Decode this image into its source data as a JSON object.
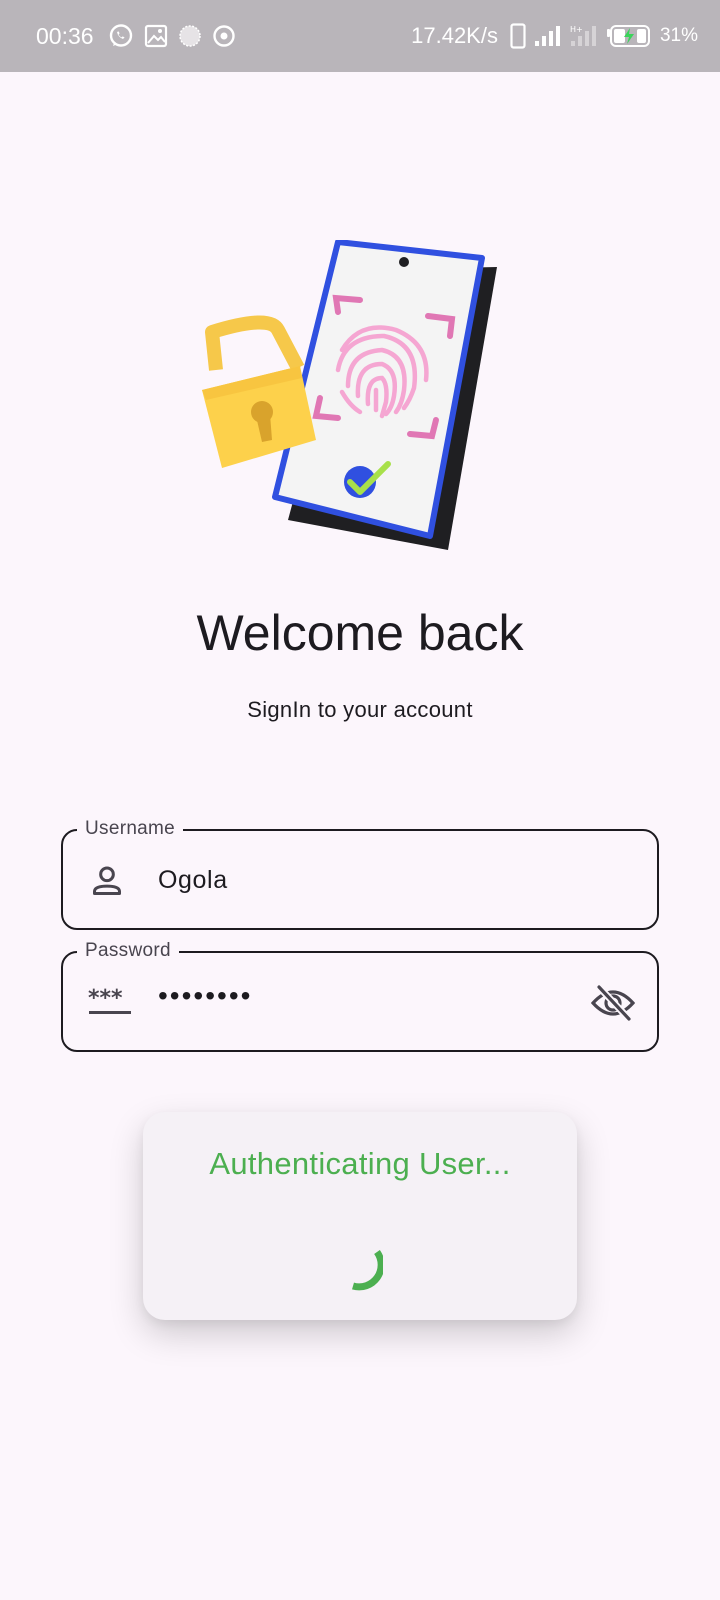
{
  "status_bar": {
    "time": "00:36",
    "network_speed": "17.42K/s",
    "battery_percent": "31%",
    "icons": [
      "whatsapp-icon",
      "gallery-icon",
      "circle-dot-icon",
      "target-icon",
      "phone-outline-icon",
      "signal-icon",
      "signal-h-icon",
      "battery-charging-icon"
    ]
  },
  "header": {
    "title": "Welcome back",
    "subtitle": "SignIn to your account"
  },
  "form": {
    "username": {
      "label": "Username",
      "value": "Ogola",
      "icon": "person-icon"
    },
    "password": {
      "label": "Password",
      "value": "••••••••",
      "icon": "password-icon",
      "trailing_icon": "visibility-off-icon"
    }
  },
  "dialog": {
    "message": "Authenticating User...",
    "spinner_icon": "loading-spinner-icon"
  },
  "colors": {
    "background": "#fcf6fc",
    "status_bar": "#b9b5ba",
    "accent_green": "#4caf50",
    "text": "#1d1b20",
    "lock_yellow": "#fdd14b",
    "phone_blue": "#3050e0",
    "fingerprint_pink": "#f5a6d2"
  }
}
